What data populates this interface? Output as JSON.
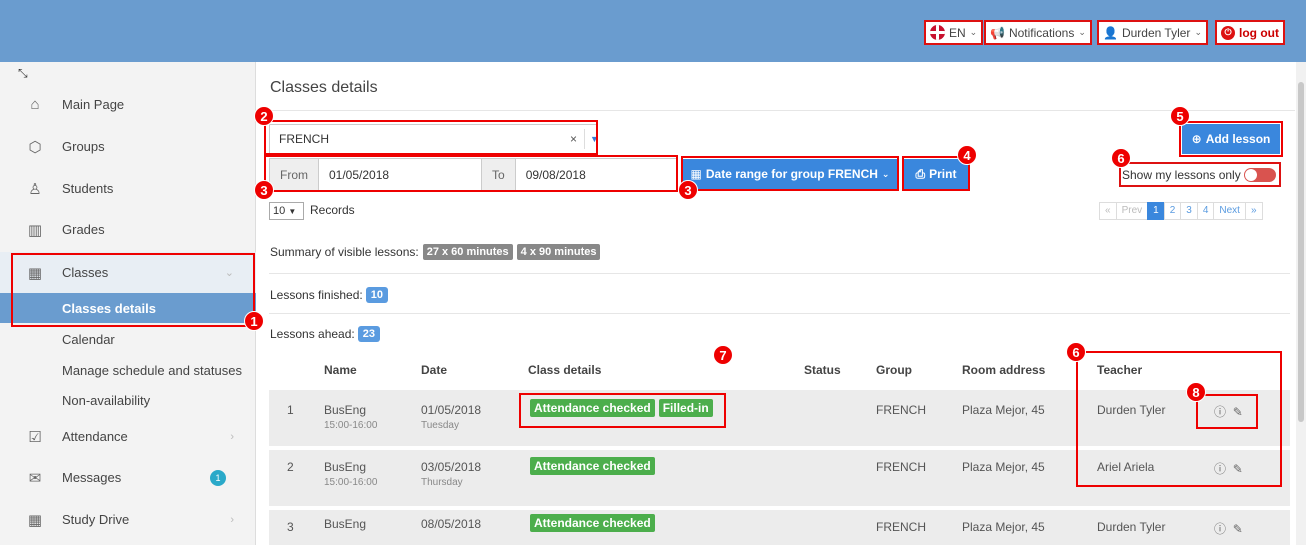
{
  "topbar": {
    "lang": "EN",
    "notifications": "Notifications",
    "user": "Durden Tyler",
    "logout": "log out"
  },
  "sidebar": {
    "items": [
      {
        "label": "Main Page",
        "icon": "home-icon"
      },
      {
        "label": "Groups",
        "icon": "cube-icon"
      },
      {
        "label": "Students",
        "icon": "user-icon"
      },
      {
        "label": "Grades",
        "icon": "book-icon"
      },
      {
        "label": "Classes",
        "icon": "calendar-icon"
      },
      {
        "label": "Attendance",
        "icon": "checkbox-icon"
      },
      {
        "label": "Messages",
        "icon": "envelope-icon"
      },
      {
        "label": "Study Drive",
        "icon": "calendar-icon"
      }
    ],
    "subitems": [
      "Classes details",
      "Calendar",
      "Manage schedule and statuses",
      "Non-availability"
    ],
    "messages_badge": "1"
  },
  "main": {
    "title": "Classes details",
    "group_select": "FRENCH",
    "from_label": "From",
    "from_value": "01/05/2018",
    "to_label": "To",
    "to_value": "09/08/2018",
    "date_range_btn": "Date range for group FRENCH",
    "print_btn": "Print",
    "add_lesson_btn": "Add lesson",
    "show_my_lessons": "Show my lessons only",
    "records_value": "10",
    "records_label": "Records",
    "summary_label": "Summary of visible lessons:",
    "summary_badge1": "27 x 60 minutes",
    "summary_badge2": "4 x 90 minutes",
    "finished_label": "Lessons finished:",
    "finished_count": "10",
    "ahead_label": "Lessons ahead:",
    "ahead_count": "23",
    "pager": {
      "first": "«",
      "prev": "Prev",
      "pages": [
        "1",
        "2",
        "3",
        "4"
      ],
      "next": "Next",
      "last": "»"
    }
  },
  "table": {
    "headers": [
      "Name",
      "Date",
      "Class details",
      "Status",
      "Group",
      "Room address",
      "Teacher"
    ],
    "rows": [
      {
        "n": "1",
        "name": "BusEng",
        "time": "15:00-16:00",
        "date": "01/05/2018",
        "day": "Tuesday",
        "tags": [
          "Attendance checked",
          "Filled-in"
        ],
        "group": "FRENCH",
        "room": "Plaza Mejor, 45",
        "teacher": "Durden Tyler"
      },
      {
        "n": "2",
        "name": "BusEng",
        "time": "15:00-16:00",
        "date": "03/05/2018",
        "day": "Thursday",
        "tags": [
          "Attendance checked"
        ],
        "group": "FRENCH",
        "room": "Plaza Mejor, 45",
        "teacher": "Ariel Ariela"
      },
      {
        "n": "3",
        "name": "BusEng",
        "time": "",
        "date": "08/05/2018",
        "day": "",
        "tags": [
          "Attendance checked"
        ],
        "group": "FRENCH",
        "room": "Plaza Mejor, 45",
        "teacher": "Durden Tyler"
      }
    ]
  },
  "annotations": [
    "1",
    "2",
    "3",
    "3",
    "4",
    "5",
    "6",
    "6",
    "7",
    "8"
  ],
  "colors": {
    "accent": "#6a9ccf",
    "primary_button": "#3a87dd",
    "annotation": "#e00000",
    "success": "#4cae4c"
  }
}
